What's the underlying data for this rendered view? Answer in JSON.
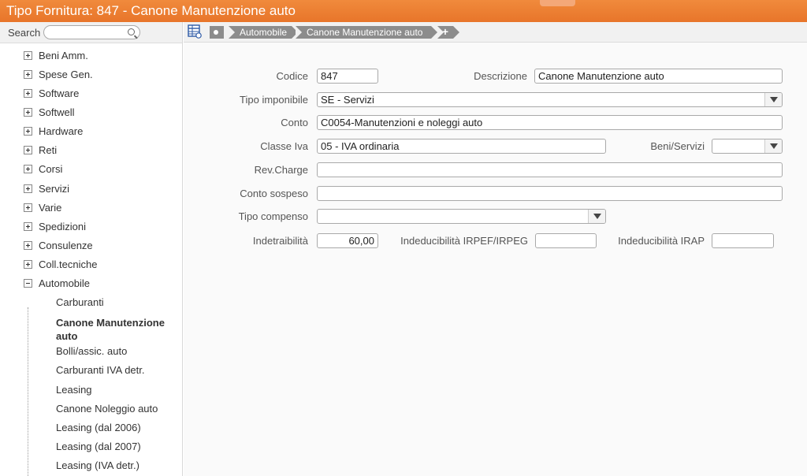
{
  "window": {
    "title": "Tipo Fornitura: 847 - Canone Manutenzione auto"
  },
  "sidebar": {
    "search_label": "Search",
    "items": [
      {
        "label": "Beni Amm."
      },
      {
        "label": "Spese Gen."
      },
      {
        "label": "Software"
      },
      {
        "label": "Softwell"
      },
      {
        "label": "Hardware"
      },
      {
        "label": "Reti"
      },
      {
        "label": "Corsi"
      },
      {
        "label": "Servizi"
      },
      {
        "label": "Varie"
      },
      {
        "label": "Spedizioni"
      },
      {
        "label": "Consulenze"
      },
      {
        "label": "Coll.tecniche"
      },
      {
        "label": "Automobile"
      }
    ],
    "children": [
      {
        "label": "Carburanti"
      },
      {
        "label": "Canone Manutenzione"
      },
      {
        "label": "auto"
      },
      {
        "label": "Bolli/assic. auto"
      },
      {
        "label": "Carburanti IVA detr."
      },
      {
        "label": "Leasing"
      },
      {
        "label": "Canone Noleggio auto"
      },
      {
        "label": "Leasing (dal 2006)"
      },
      {
        "label": "Leasing (dal 2007)"
      },
      {
        "label": "Leasing (IVA detr.)"
      }
    ]
  },
  "breadcrumb": {
    "items": [
      "Automobile",
      "Canone Manutenzione auto"
    ],
    "add": "+"
  },
  "form": {
    "codice": {
      "label": "Codice",
      "value": "847"
    },
    "descrizione": {
      "label": "Descrizione",
      "value": "Canone Manutenzione auto"
    },
    "tipo_imponibile": {
      "label": "Tipo imponibile",
      "value": "SE - Servizi"
    },
    "conto": {
      "label": "Conto",
      "value": "C0054-Manutenzioni e noleggi auto"
    },
    "classe_iva": {
      "label": "Classe Iva",
      "value": "05 - IVA ordinaria"
    },
    "beni_servizi": {
      "label": "Beni/Servizi",
      "value": ""
    },
    "rev_charge": {
      "label": "Rev.Charge",
      "value": ""
    },
    "conto_sospeso": {
      "label": "Conto sospeso",
      "value": ""
    },
    "tipo_compenso": {
      "label": "Tipo compenso",
      "value": ""
    },
    "indetraibilita": {
      "label": "Indetraibilità",
      "value": "60,00"
    },
    "ind_irpef": {
      "label": "Indeducibilità IRPEF/IRPEG",
      "value": ""
    },
    "ind_irap": {
      "label": "Indeducibilità IRAP",
      "value": ""
    }
  }
}
